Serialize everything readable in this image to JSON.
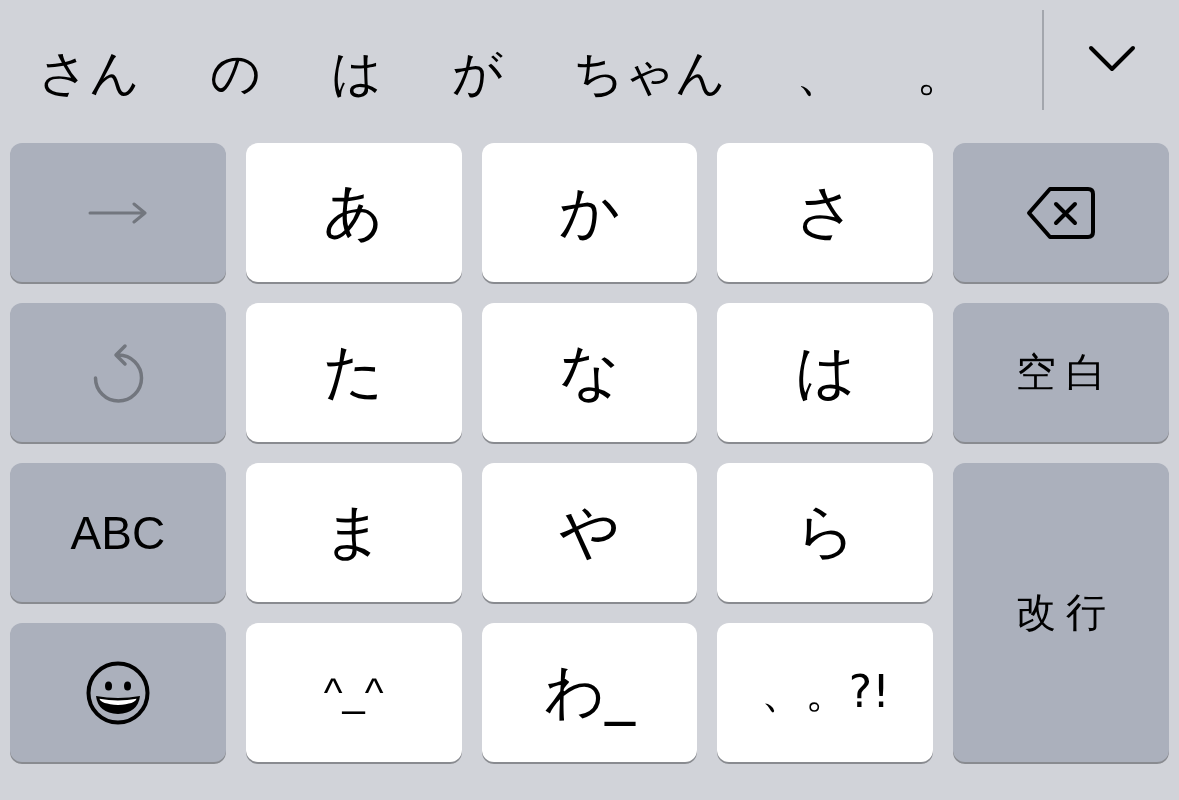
{
  "suggestion_bar": {
    "candidates": [
      "さん",
      "の",
      "は",
      "が",
      "ちゃん",
      "、",
      "。"
    ]
  },
  "keyboard": {
    "rows": [
      {
        "keys": [
          {
            "kind": "next",
            "disabled": true
          },
          {
            "kind": "kana",
            "label": "あ",
            "disabled": false
          },
          {
            "kind": "kana",
            "label": "か",
            "disabled": false
          },
          {
            "kind": "kana",
            "label": "さ",
            "disabled": false
          },
          {
            "kind": "delete",
            "disabled": false
          }
        ]
      },
      {
        "keys": [
          {
            "kind": "undo",
            "disabled": true
          },
          {
            "kind": "kana",
            "label": "た",
            "disabled": false
          },
          {
            "kind": "kana",
            "label": "な",
            "disabled": false
          },
          {
            "kind": "kana",
            "label": "は",
            "disabled": false
          },
          {
            "kind": "space",
            "label": "空白",
            "disabled": false
          }
        ]
      },
      {
        "keys": [
          {
            "kind": "mode",
            "label": "ABC",
            "disabled": false
          },
          {
            "kind": "kana",
            "label": "ま",
            "disabled": false
          },
          {
            "kind": "kana",
            "label": "や",
            "disabled": false
          },
          {
            "kind": "kana",
            "label": "ら",
            "disabled": false
          },
          {
            "kind": "return",
            "label": "改行",
            "disabled": false
          }
        ]
      },
      {
        "keys": [
          {
            "kind": "emoji",
            "disabled": false
          },
          {
            "kind": "emoticon",
            "label": "^_^",
            "disabled": false
          },
          {
            "kind": "kana",
            "label": "わ_",
            "disabled": false
          },
          {
            "kind": "punctuation",
            "label": "、。?!",
            "disabled": false
          }
        ]
      }
    ]
  }
}
